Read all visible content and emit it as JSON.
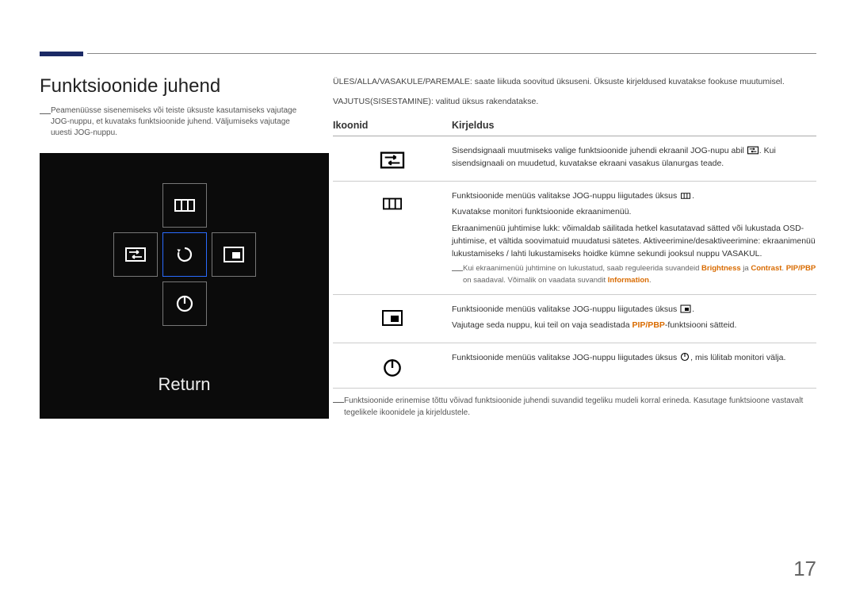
{
  "page_number": "17",
  "title": "Funktsioonide juhend",
  "left_note": "Peamenüüsse sisenemiseks või teiste üksuste kasutamiseks vajutage JOG-nuppu, et kuvataks funktsioonide juhend. Väljumiseks vajutage uuesti JOG-nuppu.",
  "osd": {
    "return_label": "Return"
  },
  "intro_line1": "ÜLES/ALLA/VASAKULE/PAREMALE: saate liikuda soovitud üksuseni. Üksuste kirjeldused kuvatakse fookuse muutumisel.",
  "intro_line2": "VAJUTUS(SISESTAMINE): valitud üksus rakendatakse.",
  "table": {
    "header_icons": "Ikoonid",
    "header_desc": "Kirjeldus",
    "row1": {
      "text_a": "Sisendsignaali muutmiseks valige funktsioonide juhendi ekraanil JOG-nupu abil ",
      "text_b": ". Kui sisendsignaali on muudetud, kuvatakse ekraani vasakus ülanurgas teade."
    },
    "row2": {
      "line1_a": "Funktsioonide menüüs valitakse JOG-nuppu liigutades üksus ",
      "line1_b": ".",
      "line2": "Kuvatakse monitori funktsioonide ekraanimenüü.",
      "line3": "Ekraanimenüü juhtimise lukk: võimaldab säilitada hetkel kasutatavad sätted või lukustada OSD-juhtimise, et vältida soovimatuid muudatusi sätetes. Aktiveerimine/desaktiveerimine: ekraanimenüü lukustamiseks / lahti lukustamiseks hoidke kümne sekundi jooksul nuppu VASAKUL.",
      "sub_a": "Kui ekraanimenüü juhtimine on lukustatud, saab reguleerida suvandeid ",
      "sub_brightness": "Brightness",
      "sub_and": " ja ",
      "sub_contrast": "Contrast",
      "sub_dot": ". ",
      "sub_pip": "PIP/PBP",
      "sub_b": " on saadaval. Võimalik on vaadata suvandit ",
      "sub_info": "Information",
      "sub_end": "."
    },
    "row3": {
      "line1_a": "Funktsioonide menüüs valitakse JOG-nuppu liigutades üksus ",
      "line1_b": ".",
      "line2_a": "Vajutage seda nuppu, kui teil on vaja seadistada ",
      "line2_pip": "PIP/PBP",
      "line2_b": "-funktsiooni sätteid."
    },
    "row4": {
      "text_a": "Funktsioonide menüüs valitakse JOG-nuppu liigutades üksus ",
      "text_b": ", mis lülitab monitori välja."
    }
  },
  "footnote": "Funktsioonide erinemise tõttu võivad funktsioonide juhendi suvandid tegeliku mudeli korral erineda. Kasutage funktsioone vastavalt tegelikele ikoonidele ja kirjeldustele."
}
